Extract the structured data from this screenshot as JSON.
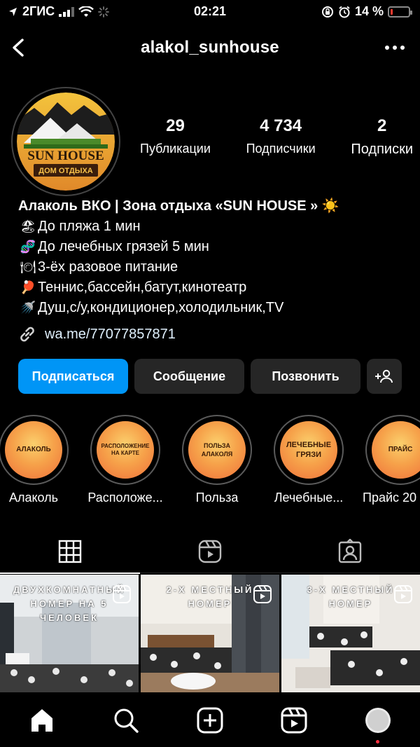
{
  "status": {
    "carrier": "2ГИС",
    "time": "02:21",
    "battery": "14 %",
    "battery_level": 0.14
  },
  "header": {
    "username": "alakol_sunhouse",
    "back_icon": "chevron-left-icon",
    "more_icon": "more-horizontal-icon"
  },
  "profile": {
    "avatar_text_top": "SUN HOUSE",
    "avatar_text_bottom": "ДОМ ОТДЫХА",
    "stats": [
      {
        "num": "29",
        "label": "Публикации"
      },
      {
        "num": "4 734",
        "label": "Подписчики"
      },
      {
        "num": "2",
        "label": "Подписки"
      }
    ]
  },
  "bio": {
    "name": "Алаколь ВКО  | Зона отдыха «SUN HOUSE » ☀️",
    "lines": [
      {
        "emoji": "🏖",
        "text": "До пляжа 1 мин"
      },
      {
        "emoji": "🧬",
        "text": "До лечебных грязей 5 мин"
      },
      {
        "emoji": "🍽",
        "text": "3-ёх разовое питание"
      },
      {
        "emoji": "🏓",
        "text": "Теннис,бассейн,батут,кинотеатр"
      },
      {
        "emoji": "🚿",
        "text": "Душ,с/у,кондиционер,холодильник,TV"
      }
    ],
    "link": "wa.me/77077857871"
  },
  "actions": {
    "follow": "Подписаться",
    "message": "Сообщение",
    "call": "Позвонить"
  },
  "highlights": [
    {
      "inner": "АЛАКОЛЬ",
      "label": "Алаколь"
    },
    {
      "inner": "РАСПОЛОЖЕНИЕ НА КАРТЕ",
      "label": "Расположе..."
    },
    {
      "inner": "ПОЛЬЗА АЛАКОЛЯ",
      "label": "Польза"
    },
    {
      "inner": "ЛЕЧЕБНЫЕ ГРЯЗИ",
      "label": "Лечебные..."
    },
    {
      "inner": "ПРАЙС",
      "label": "Прайс 20"
    }
  ],
  "posts": [
    {
      "caption": "ДВУХКОМНАТНЫЙ НОМЕР НА 5 ЧЕЛОВЕК"
    },
    {
      "caption": "2-Х МЕСТНЫЙ НОМЕР"
    },
    {
      "caption": "3-Х МЕСТНЫЙ НОМЕР"
    }
  ],
  "colors": {
    "primary": "#0095f6",
    "button_bg": "#262626",
    "notification": "#ff3040"
  }
}
